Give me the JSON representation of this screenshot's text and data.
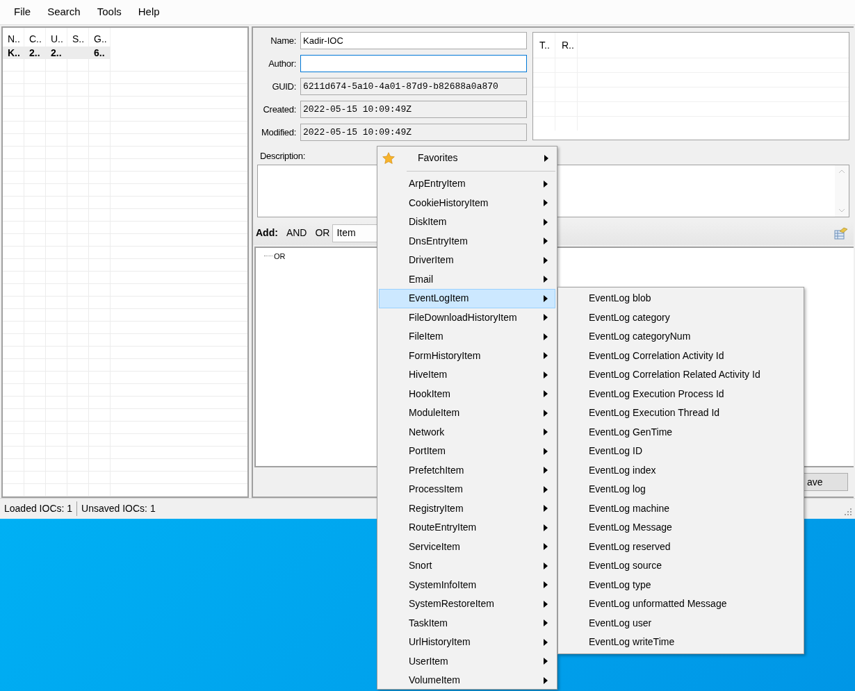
{
  "menu_bar": [
    "File",
    "Search",
    "Tools",
    "Help"
  ],
  "ioc_list": {
    "columns": [
      "N..",
      "C..",
      "U..",
      "S..",
      "G.."
    ],
    "rows": [
      {
        "cells": [
          "K..",
          "2..",
          "2..",
          "",
          "6.."
        ],
        "selected": true
      }
    ]
  },
  "fields": [
    {
      "label": "Name:",
      "value": "Kadir-IOC",
      "readonly": false,
      "focused": false
    },
    {
      "label": "Author:",
      "readonly": false,
      "focused": true
    },
    {
      "label": "GUID:",
      "value": "6211d674-5a10-4a01-87d9-b82688a0a870",
      "readonly": true,
      "focused": false
    },
    {
      "label": "Created:",
      "value": "2022-05-15 10:09:49Z",
      "readonly": true,
      "focused": false
    },
    {
      "label": "Modified:",
      "value": "2022-05-15 10:09:49Z",
      "readonly": true,
      "focused": false
    }
  ],
  "links_table": {
    "columns": [
      "T..",
      "R.."
    ]
  },
  "description": {
    "label": "Description:"
  },
  "add_toolbar": {
    "label": "Add:",
    "and_button": "AND",
    "or_button": "OR",
    "item_select": "Item"
  },
  "tree": {
    "nodes": [
      {
        "label": "OR"
      }
    ]
  },
  "save_button": "ave",
  "status_bar": [
    "Loaded IOCs: 1",
    "Unsaved IOCs: 1"
  ],
  "context_menu": {
    "favorites": "Favorites",
    "items": [
      {
        "label": "ArpEntryItem",
        "selected": false
      },
      {
        "label": "CookieHistoryItem",
        "selected": false
      },
      {
        "label": "DiskItem",
        "selected": false
      },
      {
        "label": "DnsEntryItem",
        "selected": false
      },
      {
        "label": "DriverItem",
        "selected": false
      },
      {
        "label": "Email",
        "selected": false
      },
      {
        "label": "EventLogItem",
        "selected": true
      },
      {
        "label": "FileDownloadHistoryItem",
        "selected": false
      },
      {
        "label": "FileItem",
        "selected": false
      },
      {
        "label": "FormHistoryItem",
        "selected": false
      },
      {
        "label": "HiveItem",
        "selected": false
      },
      {
        "label": "HookItem",
        "selected": false
      },
      {
        "label": "ModuleItem",
        "selected": false
      },
      {
        "label": "Network",
        "selected": false
      },
      {
        "label": "PortItem",
        "selected": false
      },
      {
        "label": "PrefetchItem",
        "selected": false
      },
      {
        "label": "ProcessItem",
        "selected": false
      },
      {
        "label": "RegistryItem",
        "selected": false
      },
      {
        "label": "RouteEntryItem",
        "selected": false
      },
      {
        "label": "ServiceItem",
        "selected": false
      },
      {
        "label": "Snort",
        "selected": false
      },
      {
        "label": "SystemInfoItem",
        "selected": false
      },
      {
        "label": "SystemRestoreItem",
        "selected": false
      },
      {
        "label": "TaskItem",
        "selected": false
      },
      {
        "label": "UrlHistoryItem",
        "selected": false
      },
      {
        "label": "UserItem",
        "selected": false
      },
      {
        "label": "VolumeItem",
        "selected": false
      }
    ]
  },
  "submenu": {
    "items": [
      "EventLog blob",
      "EventLog category",
      "EventLog categoryNum",
      "EventLog Correlation Activity Id",
      "EventLog Correlation Related Activity Id",
      "EventLog Execution Process Id",
      "EventLog Execution Thread Id",
      "EventLog GenTime",
      "EventLog ID",
      "EventLog index",
      "EventLog log",
      "EventLog machine",
      "EventLog Message",
      "EventLog reserved",
      "EventLog source",
      "EventLog type",
      "EventLog unformatted Message",
      "EventLog user",
      "EventLog writeTime"
    ]
  }
}
